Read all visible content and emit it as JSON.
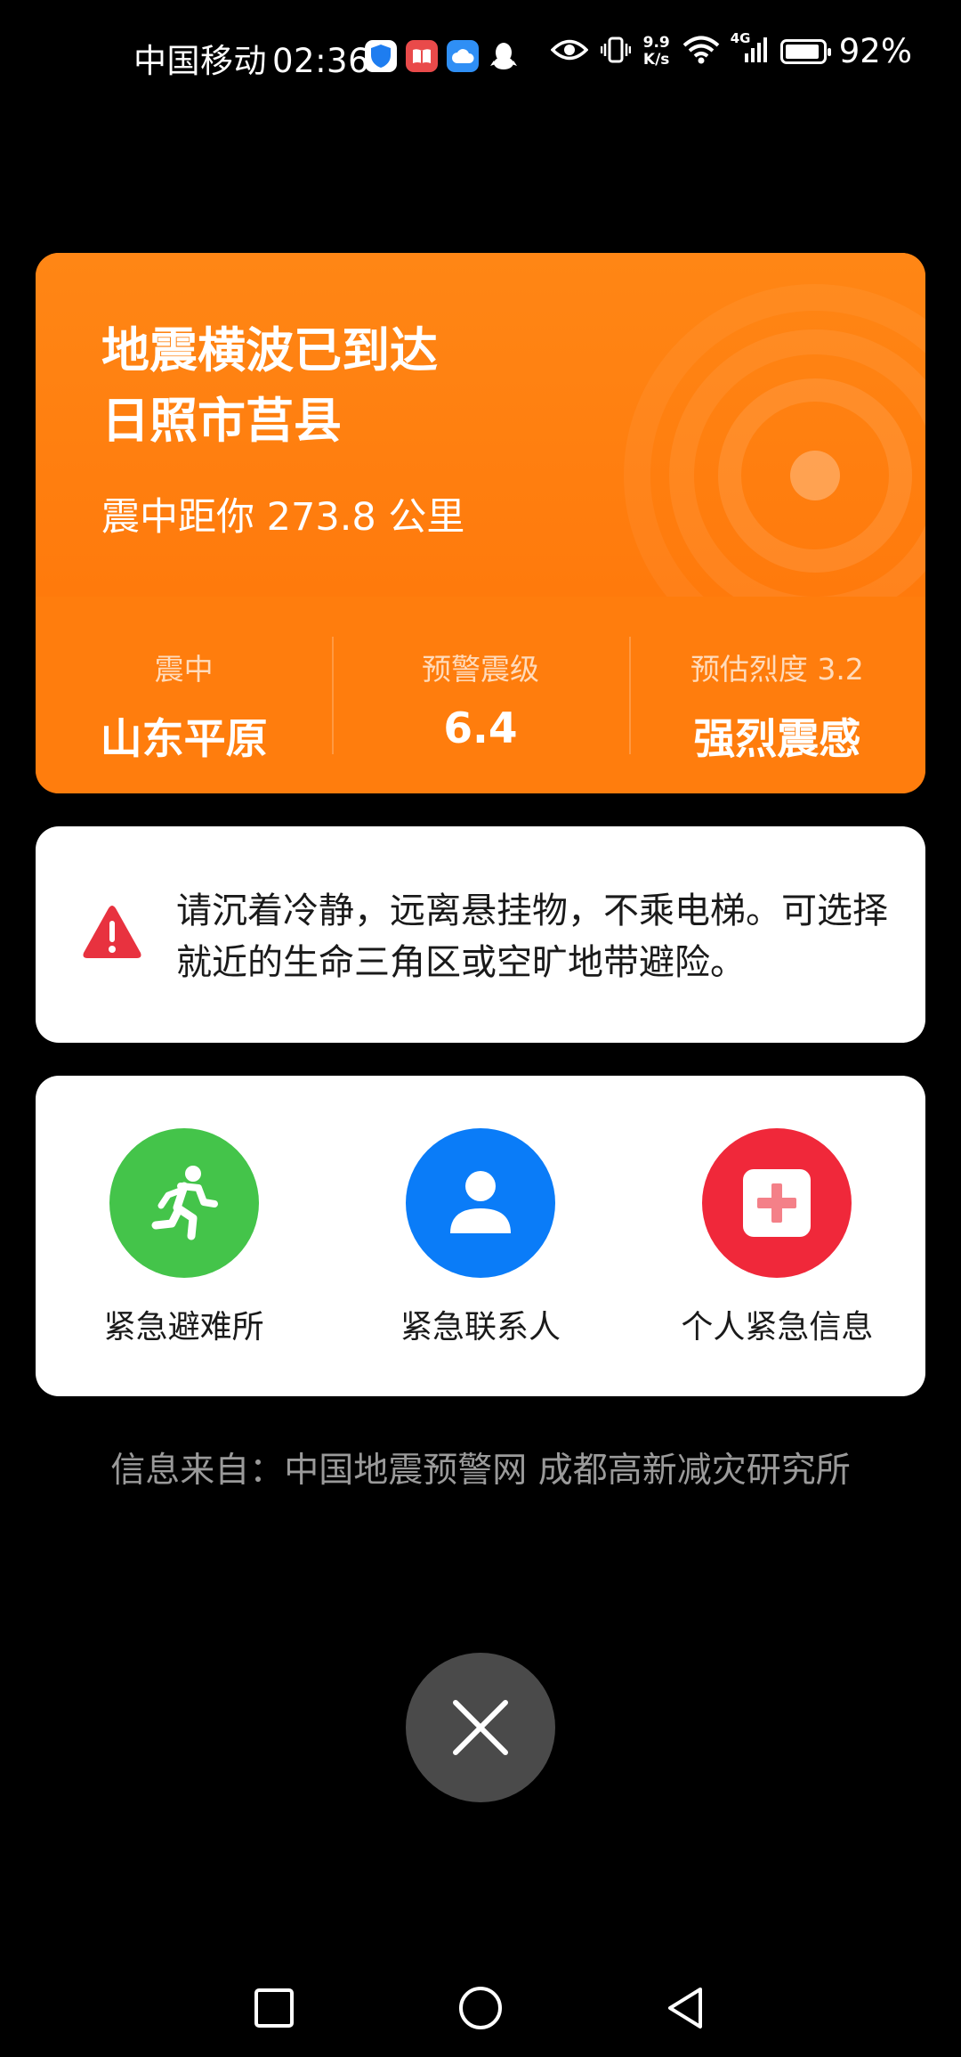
{
  "status_bar": {
    "carrier": "中国移动",
    "time": "02:36",
    "net_speed_value": "9.9",
    "net_speed_unit": "K/s",
    "signal_type": "4G",
    "battery_percent_text": "92%",
    "battery_level": 0.92
  },
  "alert": {
    "title_line1": "地震横波已到达",
    "title_line2": "日照市莒县",
    "distance_text": "震中距你 273.8 公里",
    "stats": [
      {
        "label": "震中",
        "value": "山东平原"
      },
      {
        "label": "预警震级",
        "value": "6.4"
      },
      {
        "label": "预估烈度 3.2",
        "value": "强烈震感"
      }
    ]
  },
  "advice": {
    "text": "请沉着冷静，远离悬挂物，不乘电梯。可选择就近的生命三角区或空旷地带避险。"
  },
  "actions": [
    {
      "label": "紧急避难所",
      "icon": "running-person-icon",
      "color": "#44c44a"
    },
    {
      "label": "紧急联系人",
      "icon": "person-icon",
      "color": "#0a7cf8"
    },
    {
      "label": "个人紧急信息",
      "icon": "medical-cross-icon",
      "color": "#f0283a"
    }
  ],
  "source_text": "信息来自：中国地震预警网 成都高新减灾研究所",
  "colors": {
    "alert_orange": "#ff7e0a",
    "warning_red": "#e8323f",
    "background": "#000000"
  }
}
